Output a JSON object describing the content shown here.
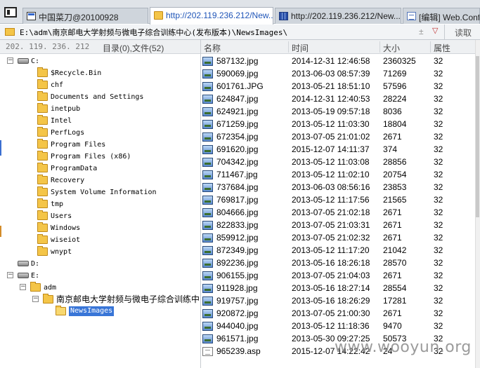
{
  "tabs": [
    {
      "label": "中国菜刀@20100928",
      "icon": "window-icon",
      "active": false
    },
    {
      "label": "http://202.119.236.212/New...",
      "icon": "folder-icon",
      "active": true
    },
    {
      "label": "http://202.119.236.212/New...",
      "icon": "database-icon",
      "active": false
    },
    {
      "label": "[编辑] Web.Config",
      "icon": "document-icon",
      "active": false
    }
  ],
  "address": {
    "path": "E:\\adm\\南京邮电大学射频与微电子综合训练中心(发布版本)\\NewsImages\\",
    "up_glyph": "±",
    "dropdown_glyph": "▽",
    "read_label": "读取"
  },
  "left_header": {
    "server": "202. 119. 236. 212",
    "summary": "目录(0),文件(52)"
  },
  "tree": [
    {
      "label": "C:",
      "type": "drive",
      "expander": "−",
      "depth": 0
    },
    {
      "label": "$Recycle.Bin",
      "type": "folder",
      "depth": 1
    },
    {
      "label": "chf",
      "type": "folder",
      "depth": 1
    },
    {
      "label": "Documents and Settings",
      "type": "folder",
      "depth": 1
    },
    {
      "label": "inetpub",
      "type": "folder",
      "depth": 1
    },
    {
      "label": "Intel",
      "type": "folder",
      "depth": 1
    },
    {
      "label": "PerfLogs",
      "type": "folder",
      "depth": 1
    },
    {
      "label": "Program Files",
      "type": "folder",
      "depth": 1
    },
    {
      "label": "Program Files (x86)",
      "type": "folder",
      "depth": 1
    },
    {
      "label": "ProgramData",
      "type": "folder",
      "depth": 1
    },
    {
      "label": "Recovery",
      "type": "folder",
      "depth": 1
    },
    {
      "label": "System Volume Information",
      "type": "folder",
      "depth": 1
    },
    {
      "label": "tmp",
      "type": "folder",
      "depth": 1
    },
    {
      "label": "Users",
      "type": "folder",
      "depth": 1
    },
    {
      "label": "Windows",
      "type": "folder",
      "depth": 1
    },
    {
      "label": "wiseiot",
      "type": "folder",
      "depth": 1
    },
    {
      "label": "wnypt",
      "type": "folder",
      "depth": 1
    },
    {
      "label": "D:",
      "type": "drive",
      "depth": 0
    },
    {
      "label": "E:",
      "type": "drive",
      "expander": "−",
      "depth": 0
    },
    {
      "label": "adm",
      "type": "folder",
      "expander": "−",
      "depth": 1
    },
    {
      "label": "南京邮电大学射频与微电子综合训练中",
      "type": "folder",
      "expander": "−",
      "depth": 2
    },
    {
      "label": "NewsImages",
      "type": "folder",
      "depth": 3,
      "selected": true
    }
  ],
  "columns": {
    "name": "名称",
    "time": "时间",
    "size": "大小",
    "attr": "属性"
  },
  "files": [
    {
      "name": "587132.jpg",
      "time": "2014-12-31 12:46:58",
      "size": "2360325",
      "attr": "32"
    },
    {
      "name": "590069.jpg",
      "time": "2013-06-03 08:57:39",
      "size": "71269",
      "attr": "32"
    },
    {
      "name": "601761.JPG",
      "time": "2013-05-21 18:51:10",
      "size": "57596",
      "attr": "32"
    },
    {
      "name": "624847.jpg",
      "time": "2014-12-31 12:40:53",
      "size": "28224",
      "attr": "32"
    },
    {
      "name": "624921.jpg",
      "time": "2013-05-19 09:57:18",
      "size": "8036",
      "attr": "32"
    },
    {
      "name": "671259.jpg",
      "time": "2013-05-12 11:03:30",
      "size": "18804",
      "attr": "32"
    },
    {
      "name": "672354.jpg",
      "time": "2013-07-05 21:01:02",
      "size": "2671",
      "attr": "32"
    },
    {
      "name": "691620.jpg",
      "time": "2015-12-07 14:11:37",
      "size": "374",
      "attr": "32"
    },
    {
      "name": "704342.jpg",
      "time": "2013-05-12 11:03:08",
      "size": "28856",
      "attr": "32"
    },
    {
      "name": "711467.jpg",
      "time": "2013-05-12 11:02:10",
      "size": "20754",
      "attr": "32"
    },
    {
      "name": "737684.jpg",
      "time": "2013-06-03 08:56:16",
      "size": "23853",
      "attr": "32"
    },
    {
      "name": "769817.jpg",
      "time": "2013-05-12 11:17:56",
      "size": "21565",
      "attr": "32"
    },
    {
      "name": "804666.jpg",
      "time": "2013-07-05 21:02:18",
      "size": "2671",
      "attr": "32"
    },
    {
      "name": "822833.jpg",
      "time": "2013-07-05 21:03:31",
      "size": "2671",
      "attr": "32"
    },
    {
      "name": "859912.jpg",
      "time": "2013-07-05 21:02:32",
      "size": "2671",
      "attr": "32"
    },
    {
      "name": "872349.jpg",
      "time": "2013-05-12 11:17:20",
      "size": "21042",
      "attr": "32"
    },
    {
      "name": "892236.jpg",
      "time": "2013-05-16 18:26:18",
      "size": "28570",
      "attr": "32"
    },
    {
      "name": "906155.jpg",
      "time": "2013-07-05 21:04:03",
      "size": "2671",
      "attr": "32"
    },
    {
      "name": "911928.jpg",
      "time": "2013-05-16 18:27:14",
      "size": "28554",
      "attr": "32"
    },
    {
      "name": "919757.jpg",
      "time": "2013-05-16 18:26:29",
      "size": "17281",
      "attr": "32"
    },
    {
      "name": "920872.jpg",
      "time": "2013-07-05 21:00:30",
      "size": "2671",
      "attr": "32"
    },
    {
      "name": "944040.jpg",
      "time": "2013-05-12 11:18:36",
      "size": "9470",
      "attr": "32"
    },
    {
      "name": "961571.jpg",
      "time": "2013-05-30 09:27:25",
      "size": "50573",
      "attr": "32"
    },
    {
      "name": "965239.asp",
      "time": "2015-12-07 14:22:42",
      "size": "24",
      "attr": "32"
    }
  ],
  "watermark": "www.wooyun.org"
}
